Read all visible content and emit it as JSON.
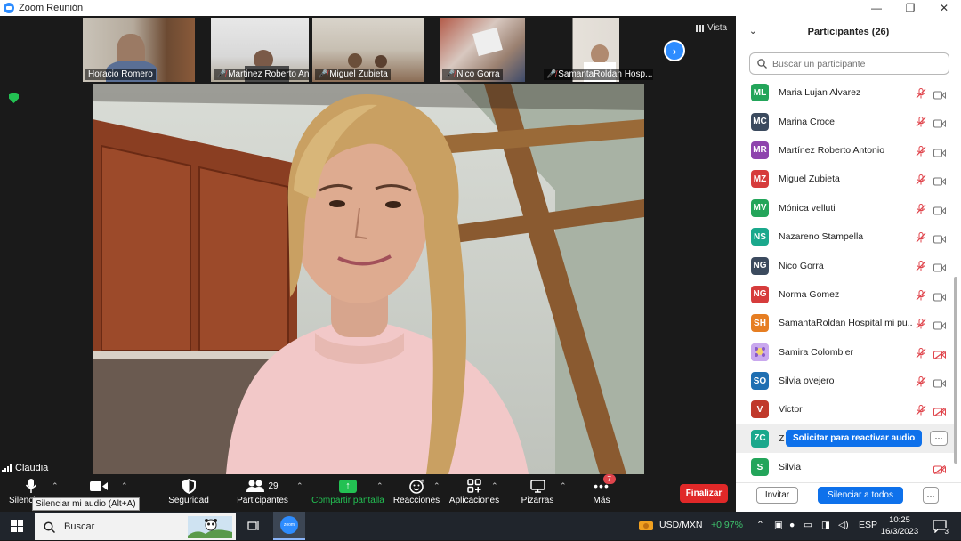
{
  "window": {
    "title": "Zoom Reunión",
    "controls": [
      "—",
      "❐",
      "✕"
    ]
  },
  "gallery": {
    "thumbnails": [
      {
        "name": "Horacio Romero",
        "muted": false
      },
      {
        "name": "Martinez Roberto Ant...",
        "muted": true
      },
      {
        "name": "Miguel Zubieta",
        "muted": true
      },
      {
        "name": "Nico Gorra",
        "muted": true
      },
      {
        "name": "SamantaRoldan Hosp...",
        "muted": true
      }
    ],
    "next_icon": "chevron-right-icon",
    "view_label": "Vista"
  },
  "speaker": {
    "self_name": "Claudia"
  },
  "toolbar": {
    "mute_label": "Silenciar",
    "mute_tooltip": "Silenciar mi audio (Alt+A)",
    "video_label": "",
    "security_label": "Seguridad",
    "participants_label": "Participantes",
    "participants_count": "29",
    "share_label": "Compartir pantalla",
    "reactions_label": "Reacciones",
    "apps_label": "Aplicaciones",
    "whiteboards_label": "Pizarras",
    "more_label": "Más",
    "more_badge": "7",
    "end_label": "Finalizar"
  },
  "panel": {
    "title": "Participantes (26)",
    "search_placeholder": "Buscar un participante",
    "participants": [
      {
        "initials": "ML",
        "name": "Maria Lujan Alvarez",
        "color": "#23a55a",
        "mic_muted": true,
        "cam_off": false
      },
      {
        "initials": "MC",
        "name": "Marina Croce",
        "color": "#3b4a5e",
        "mic_muted": true,
        "cam_off": false
      },
      {
        "initials": "MR",
        "name": "Martínez Roberto Antonio",
        "color": "#8e44ad",
        "mic_muted": true,
        "cam_off": false
      },
      {
        "initials": "MZ",
        "name": "Miguel Zubieta",
        "color": "#d63c3c",
        "mic_muted": true,
        "cam_off": false
      },
      {
        "initials": "MV",
        "name": "Mónica velluti",
        "color": "#23a55a",
        "mic_muted": true,
        "cam_off": false
      },
      {
        "initials": "NS",
        "name": "Nazareno Stampella",
        "color": "#1aa88c",
        "mic_muted": true,
        "cam_off": false
      },
      {
        "initials": "NG",
        "name": "Nico Gorra",
        "color": "#3b4a5e",
        "mic_muted": true,
        "cam_off": false
      },
      {
        "initials": "NG",
        "name": "Norma Gomez",
        "color": "#d63c3c",
        "mic_muted": true,
        "cam_off": false
      },
      {
        "initials": "SH",
        "name": "SamantaRoldan Hospital mi pu...",
        "color": "#e67e22",
        "mic_muted": true,
        "cam_off": false
      },
      {
        "initials": "",
        "name": "Samira Colombier",
        "color": "#b48adf",
        "mic_muted": true,
        "cam_off": true
      },
      {
        "initials": "SO",
        "name": "Silvia ovejero",
        "color": "#1f6fb2",
        "mic_muted": true,
        "cam_off": false
      },
      {
        "initials": "V",
        "name": "Victor",
        "color": "#c0392b",
        "mic_muted": true,
        "cam_off": true
      },
      {
        "initials": "ZC",
        "name": "Z",
        "color": "#1aa88c",
        "mic_muted": false,
        "cam_off": false,
        "highlight": true,
        "action_label": "Solicitar para reactivar audio",
        "more": "···"
      },
      {
        "initials": "S",
        "name": "Silvia",
        "color": "#23a55a",
        "mic_muted": false,
        "cam_off": true
      }
    ],
    "invite_label": "Invitar",
    "mute_all_label": "Silenciar a todos",
    "more_label": "···"
  },
  "taskbar": {
    "search_label": "Buscar",
    "zoom_task_label": "zoom",
    "ticker_label": "USD/MXN",
    "ticker_change": "+0,97%",
    "language": "ESP",
    "time": "10:25",
    "date": "16/3/2023",
    "notifications_count": "3"
  }
}
